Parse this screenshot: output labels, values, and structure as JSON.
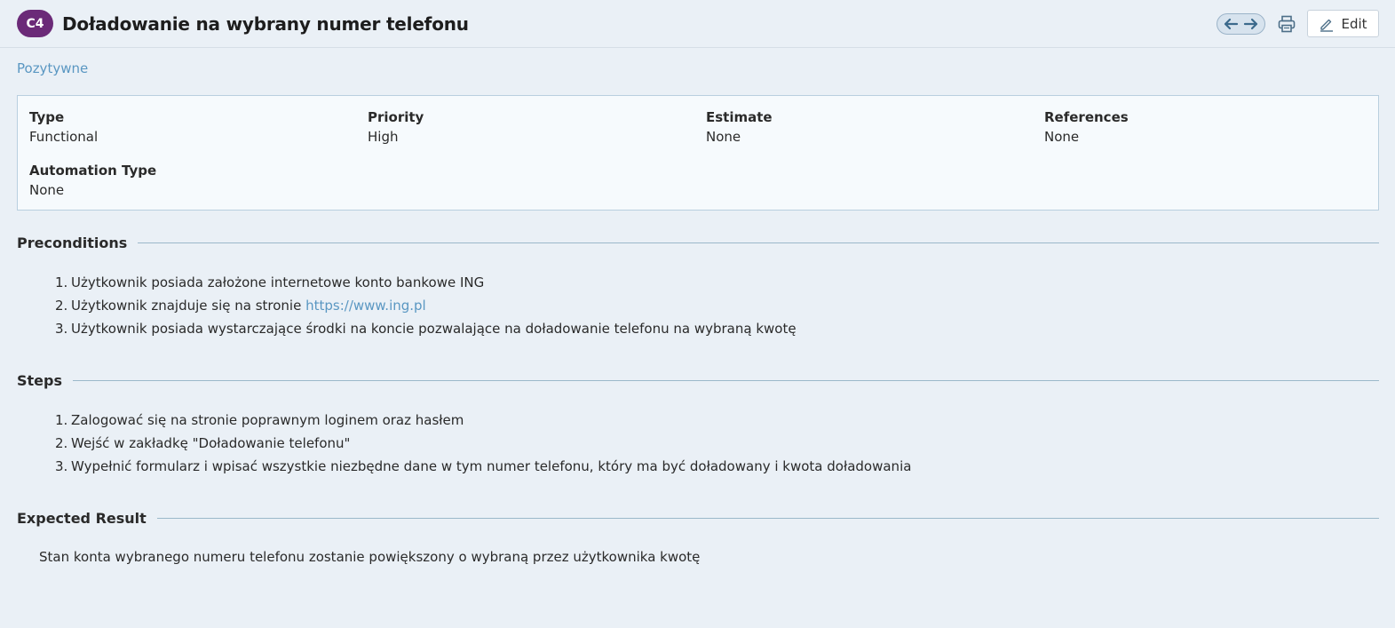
{
  "header": {
    "badge": "C4",
    "title": "Doładowanie na wybrany numer telefonu",
    "edit_label": "Edit"
  },
  "section_link": "Pozytywne",
  "properties": {
    "type": {
      "label": "Type",
      "value": "Functional"
    },
    "priority": {
      "label": "Priority",
      "value": "High"
    },
    "estimate": {
      "label": "Estimate",
      "value": "None"
    },
    "references": {
      "label": "References",
      "value": "None"
    },
    "automation_type": {
      "label": "Automation Type",
      "value": "None"
    }
  },
  "preconditions": {
    "heading": "Preconditions",
    "items": [
      {
        "num": "1.",
        "text": "Użytkownik posiada założone internetowe konto bankowe ING"
      },
      {
        "num": "2.",
        "text": "Użytkownik znajduje się na stronie ",
        "link": "https://www.ing.pl"
      },
      {
        "num": "3.",
        "text": "Użytkownik posiada wystarczające środki na koncie pozwalające na doładowanie telefonu na wybraną kwotę"
      }
    ]
  },
  "steps": {
    "heading": "Steps",
    "items": [
      {
        "num": "1.",
        "text": "Zalogować się na stronie poprawnym loginem oraz hasłem"
      },
      {
        "num": "2.",
        "text": "Wejść w zakładkę \"Doładowanie telefonu\""
      },
      {
        "num": "3.",
        "text": "Wypełnić formularz i wpisać wszystkie niezbędne dane w tym numer telefonu, który ma być doładowany i kwota doładowania"
      }
    ]
  },
  "expected_result": {
    "heading": "Expected Result",
    "text": "Stan konta wybranego numeru telefonu zostanie powiększony o wybraną przez użytkownika kwotę"
  },
  "colors": {
    "badge": "#6b2a78",
    "link": "#5a97c2",
    "background": "#eaf0f6"
  },
  "icons": [
    "arrow-left-icon",
    "arrow-right-icon",
    "printer-icon",
    "pencil-icon"
  ]
}
